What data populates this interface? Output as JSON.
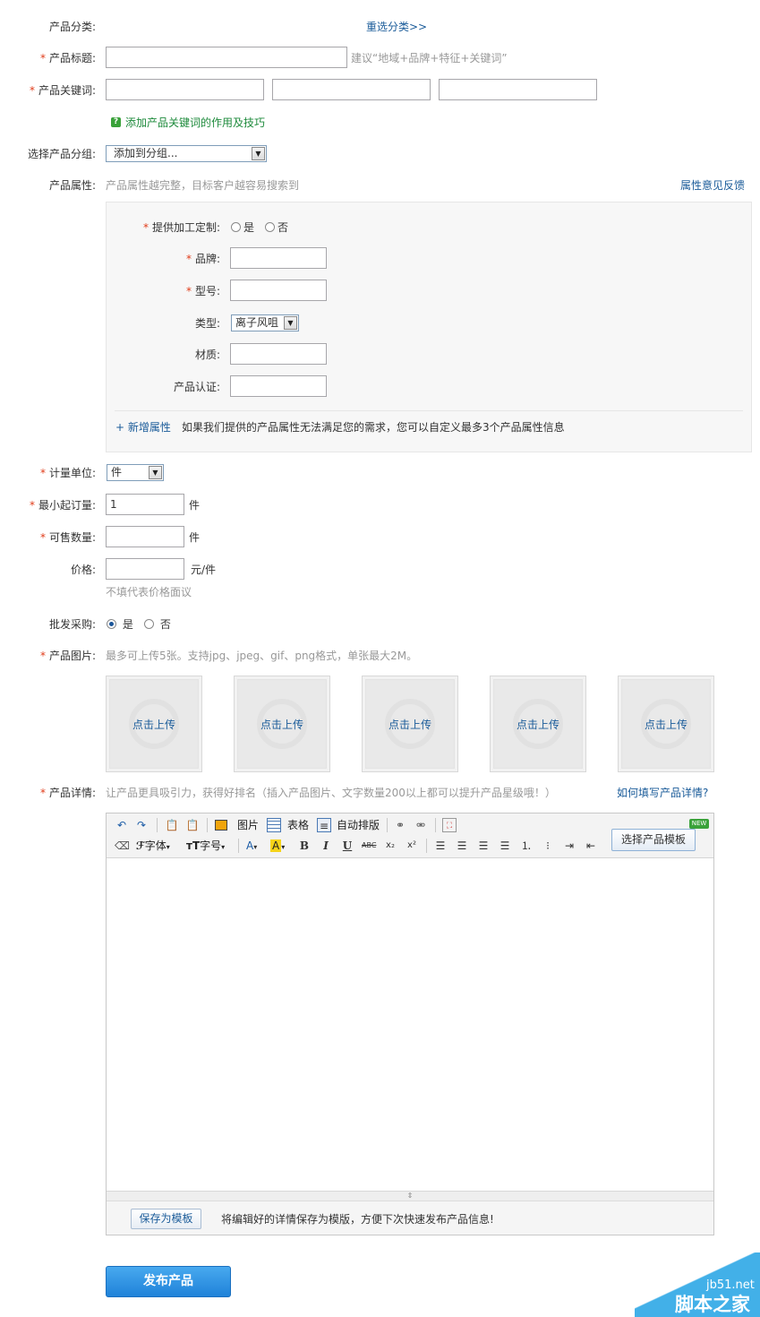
{
  "form": {
    "category": {
      "label": "产品分类:",
      "reselect": "重选分类>>"
    },
    "title": {
      "label": "产品标题:",
      "hint": "建议“地域+品牌+特征+关键词”"
    },
    "keywords": {
      "label": "产品关键词:",
      "tip": "添加产品关键词的作用及技巧"
    },
    "group": {
      "label": "选择产品分组:",
      "value": "添加到分组..."
    },
    "attributes": {
      "label": "产品属性:",
      "hint": "产品属性越完整，目标客户越容易搜索到",
      "feedback": "属性意见反馈",
      "custom": {
        "label": "提供加工定制:",
        "yes": "是",
        "no": "否"
      },
      "brand": "品牌:",
      "model": "型号:",
      "type": {
        "label": "类型:",
        "value": "离子风咀"
      },
      "material": "材质:",
      "cert": "产品认证:",
      "add_link": "+ 新增属性",
      "add_hint": "如果我们提供的产品属性无法满足您的需求，您可以自定义最多3个产品属性信息"
    },
    "unit": {
      "label": "计量单位:",
      "value": "件"
    },
    "min_order": {
      "label": "最小起订量:",
      "value": "1",
      "suffix": "件"
    },
    "stock": {
      "label": "可售数量:",
      "suffix": "件"
    },
    "price": {
      "label": "价格:",
      "suffix": "元/件",
      "note": "不填代表价格面议"
    },
    "wholesale": {
      "label": "批发采购:",
      "yes": "是",
      "no": "否"
    },
    "images": {
      "label": "产品图片:",
      "hint": "最多可上传5张。支持jpg、jpeg、gif、png格式，单张最大2M。",
      "upload_label": "点击上传"
    },
    "detail": {
      "label": "产品详情:",
      "hint": "让产品更具吸引力，获得好排名（插入产品图片、文字数量200以上都可以提升产品星级哦！）",
      "help": "如何填写产品详情?"
    }
  },
  "editor": {
    "tb_image": "图片",
    "tb_table": "表格",
    "tb_autoformat": "自动排版",
    "tb_font": "字体",
    "tb_size": "字号",
    "template_button": "选择产品模板",
    "new_badge": "NEW",
    "save_template": "保存为模板",
    "save_hint": "将编辑好的详情保存为模版，方便下次快速发布产品信息!"
  },
  "submit": "发布产品",
  "watermark": {
    "site": "jb51.net",
    "name": "脚本之家"
  },
  "colors": {
    "accent": "#1a5b99",
    "required": "#e03c1a",
    "submit_bg": "#2a92e6"
  }
}
